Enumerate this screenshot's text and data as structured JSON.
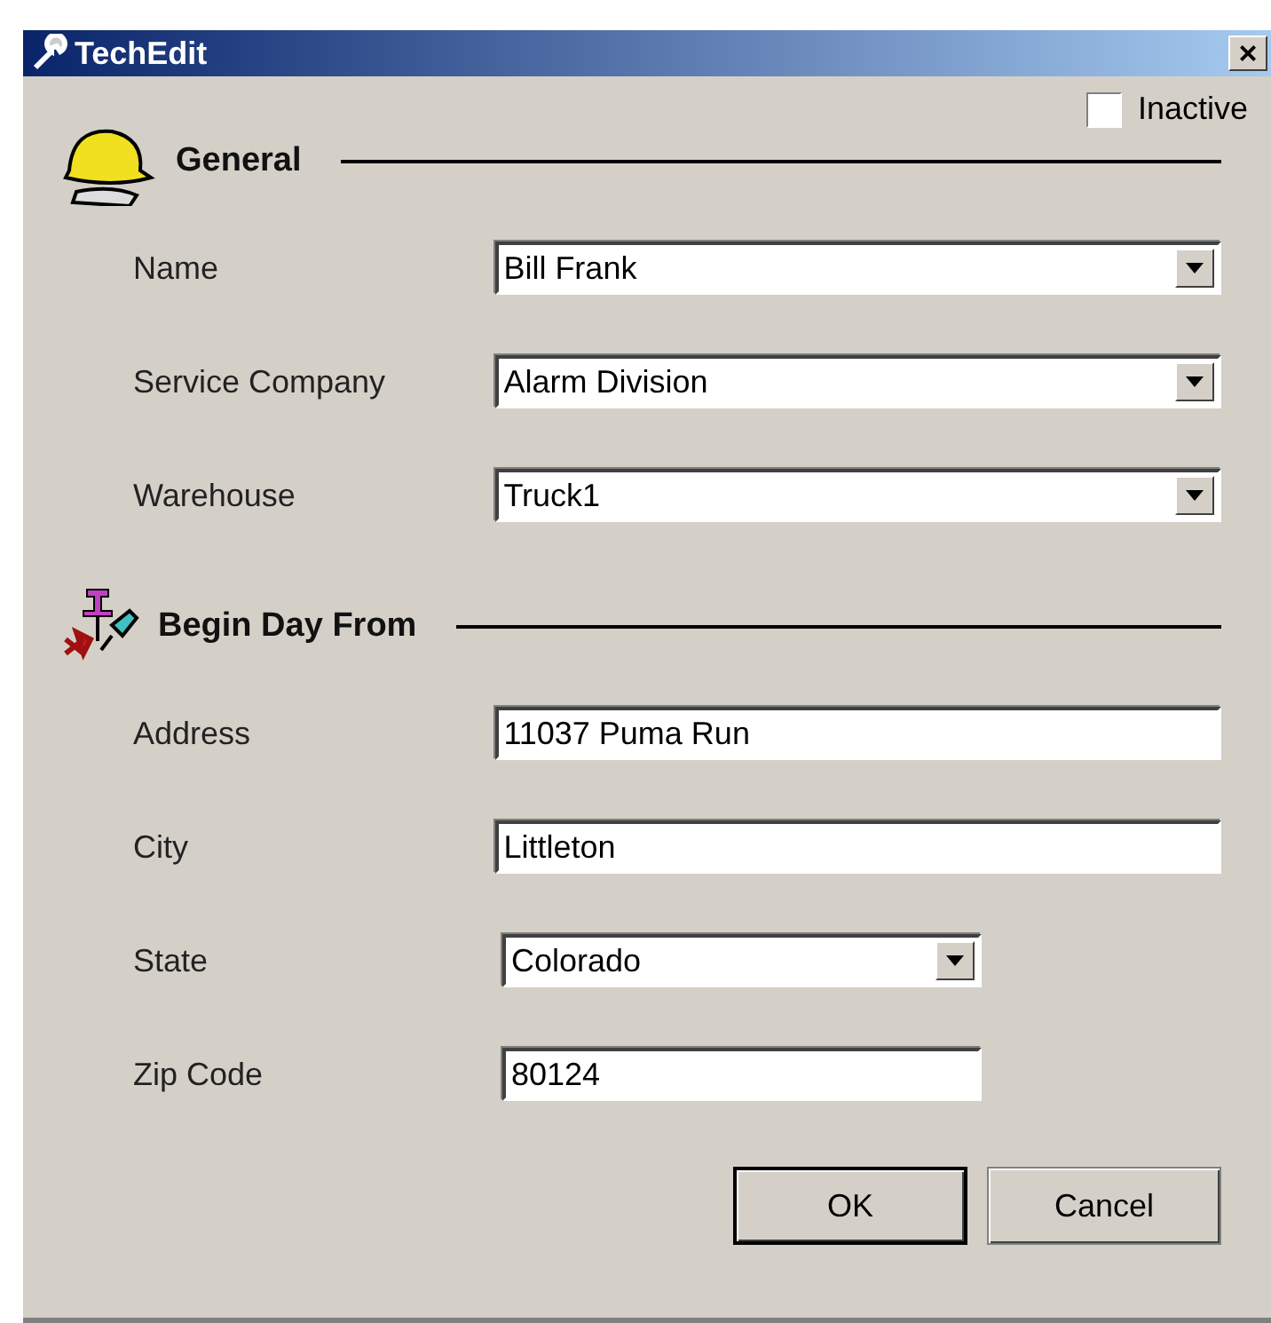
{
  "window": {
    "title": "TechEdit",
    "close": "×"
  },
  "inactive": {
    "label": "Inactive",
    "checked": false
  },
  "general": {
    "title": "General",
    "fields": [
      {
        "label": "Name",
        "value": "Bill Frank",
        "kind": "dropdown"
      },
      {
        "label": "Service Company",
        "value": "Alarm Division",
        "kind": "dropdown"
      },
      {
        "label": "Warehouse",
        "value": "Truck1",
        "kind": "dropdown"
      }
    ]
  },
  "begin_day": {
    "title": "Begin Day From",
    "fields": [
      {
        "label": "Address",
        "value": "11037 Puma Run",
        "kind": "text"
      },
      {
        "label": "City",
        "value": "Littleton",
        "kind": "text"
      },
      {
        "label": "State",
        "value": "Colorado",
        "kind": "short_dropdown"
      },
      {
        "label": "Zip Code",
        "value": "80124",
        "kind": "short_text"
      }
    ]
  },
  "buttons": [
    {
      "label": "OK",
      "default": true
    },
    {
      "label": "Cancel",
      "default": false
    }
  ]
}
